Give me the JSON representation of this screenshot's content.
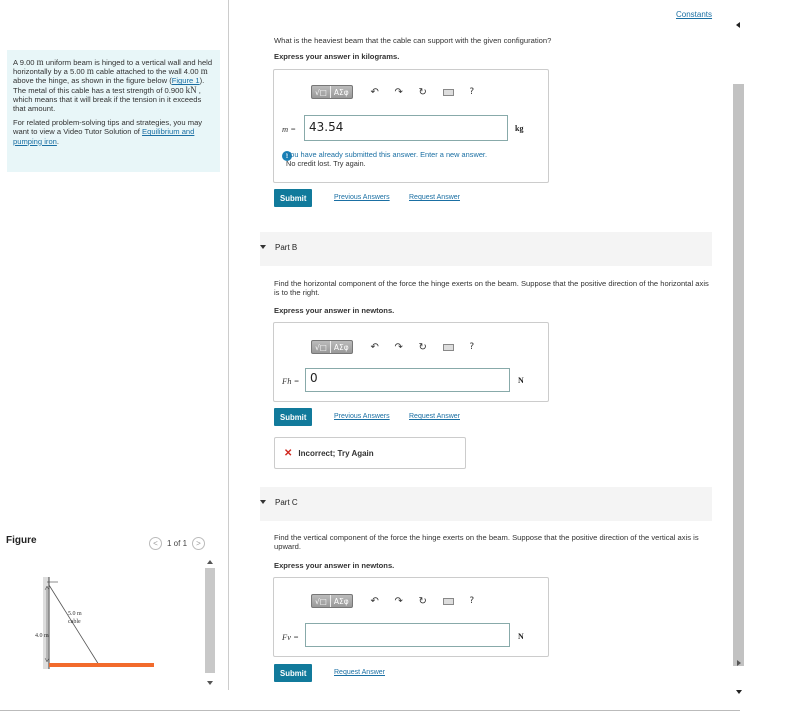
{
  "problem": {
    "p1": "A 9.00 m uniform beam is hinged to a vertical wall and held horizontally by a 5.00 m cable attached to the wall 4.00 m above the hinge, as shown in the figure below (Figure 1). The metal of this cable has a test strength of 0.900 kN , which means that it will break if the tension in it exceeds that amount.",
    "p1_a": "A 9.00 ",
    "p1_m": "m",
    "p1_b": " uniform beam is hinged to a vertical wall and held horizontally by a 5.00 ",
    "p1_c": " cable attached to the wall 4.00 ",
    "p1_d": " above the hinge, as shown in the figure below (",
    "p1_link": "Figure 1",
    "p1_e": "). The metal of this cable has a test strength of 0.900 ",
    "p1_kn": "kN",
    "p1_f": " , which means that it will break if the tension in it exceeds that amount.",
    "p2_a": "For related problem-solving tips and strategies, you may want to view a Video Tutor Solution of ",
    "p2_link": "Equilibrium and pumping iron",
    "p2_b": "."
  },
  "figure": {
    "label": "Figure",
    "pager": "1 of 1",
    "prev": "<",
    "next": ">",
    "cable_label_1": "5.0 m",
    "cable_label_2": "cable",
    "wall_label": "4.0 m"
  },
  "constants_link": "Constants",
  "part_a": {
    "question": "What is the heaviest beam that the cable can support with the given configuration?",
    "instruction": "Express your answer in kilograms.",
    "var": "m =",
    "value": "43.54",
    "unit": "kg",
    "notice_1": "You have already submitted this answer. Enter a new answer.",
    "notice_2": "No credit lost. Try again.",
    "submit": "Submit",
    "prev_answers": "Previous Answers",
    "request_answer": "Request Answer"
  },
  "part_b": {
    "title": "Part B",
    "question": "Find the horizontal component of the force the hinge exerts on the beam. Suppose that the positive direction of the horizontal axis is to the right.",
    "instruction": "Express your answer in newtons.",
    "var": "Fh =",
    "value": "0",
    "unit": "N",
    "submit": "Submit",
    "prev_answers": "Previous Answers",
    "request_answer": "Request Answer",
    "feedback": "Incorrect; Try Again",
    "feedback_icon": "✕"
  },
  "part_c": {
    "title": "Part C",
    "question": "Find the vertical component of the force the hinge exerts on the beam. Suppose that the positive direction of the vertical axis is upward.",
    "instruction": "Express your answer in newtons.",
    "var": "Fv =",
    "value": "",
    "unit": "N",
    "submit": "Submit",
    "request_answer": "Request Answer"
  },
  "toolbar": {
    "templates": "√□",
    "greek": "ΑΣφ",
    "undo": "↶",
    "redo": "↷",
    "reset": "↻",
    "help": "?"
  },
  "colors": {
    "accent": "#117a9b",
    "link": "#1a6fa3",
    "error": "#d0281f",
    "problem_bg": "#e8f6f8",
    "beam": "#f26b2c"
  }
}
